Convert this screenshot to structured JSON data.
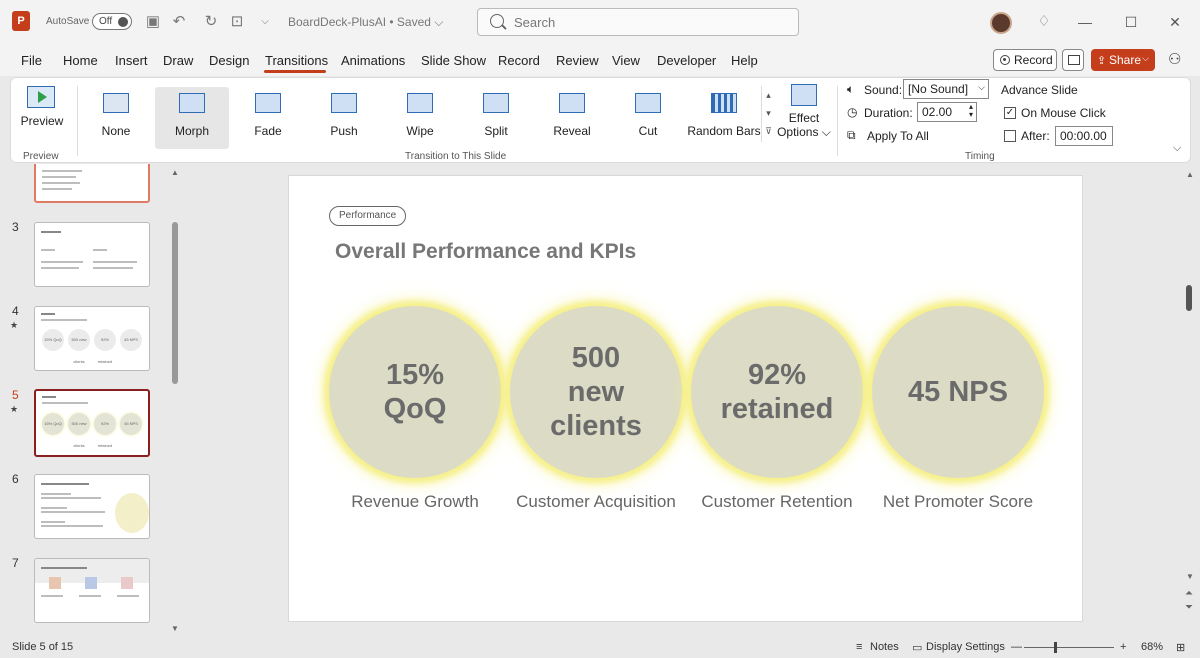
{
  "titlebar": {
    "app_initial": "P",
    "autosave_label": "AutoSave",
    "autosave_state": "Off",
    "doc_title": "BoardDeck-PlusAI • Saved ⌵",
    "search_placeholder": "Search",
    "window_controls": [
      "—",
      "☐",
      "✕"
    ]
  },
  "menu": {
    "items": [
      "File",
      "Home",
      "Insert",
      "Draw",
      "Design",
      "Transitions",
      "Animations",
      "Slide Show",
      "Record",
      "Review",
      "View",
      "Developer",
      "Help"
    ],
    "active": "Transitions",
    "record_label": "Record",
    "share_label": "Share"
  },
  "ribbon": {
    "preview_label": "Preview",
    "preview_group_label": "Preview",
    "transitions": [
      "None",
      "Morph",
      "Fade",
      "Push",
      "Wipe",
      "Split",
      "Reveal",
      "Cut",
      "Random Bars"
    ],
    "selected_transition": "Morph",
    "transitions_group_label": "Transition to This Slide",
    "effect_options_label": "Effect\nOptions ⌵",
    "sound_label": "Sound:",
    "sound_value": "[No Sound]",
    "duration_label": "Duration:",
    "duration_value": "02.00",
    "apply_all_label": "Apply To All",
    "advance_slide_label": "Advance Slide",
    "on_mouse_click_label": "On Mouse Click",
    "on_mouse_click_checked": true,
    "after_label": "After:",
    "after_value": "00:00.00",
    "after_checked": false,
    "timing_group_label": "Timing"
  },
  "thumbnails": [
    {
      "num": "3",
      "starred": false,
      "selected": false
    },
    {
      "num": "4",
      "starred": true,
      "selected": false,
      "circles": [
        "15% QoQ",
        "500 new clients",
        "92% retained",
        "45 NPS"
      ]
    },
    {
      "num": "5",
      "starred": true,
      "selected": true,
      "circles": [
        "15% QoQ",
        "500 new clients",
        "92% retained",
        "45 NPS"
      ]
    },
    {
      "num": "6",
      "starred": false,
      "selected": false
    },
    {
      "num": "7",
      "starred": false,
      "selected": false
    }
  ],
  "slide": {
    "tag": "Performance",
    "title": "Overall Performance and KPIs",
    "kpis": [
      {
        "value": "15%\nQoQ",
        "label": "Revenue Growth"
      },
      {
        "value": "500\nnew\nclients",
        "label": "Customer Acquisition"
      },
      {
        "value": "92%\nretained",
        "label": "Customer Retention"
      },
      {
        "value": "45 NPS",
        "label": "Net Promoter Score"
      }
    ]
  },
  "status": {
    "slide_counter": "Slide 5 of 15",
    "notes_label": "Notes",
    "display_settings_label": "Display Settings",
    "zoom_minus": "—",
    "zoom_plus": "+",
    "zoom_level": "68%"
  },
  "colors": {
    "accent": "#c43e1c",
    "kpi_fill": "#dcdcc6",
    "kpi_glow": "#f6f08a"
  }
}
